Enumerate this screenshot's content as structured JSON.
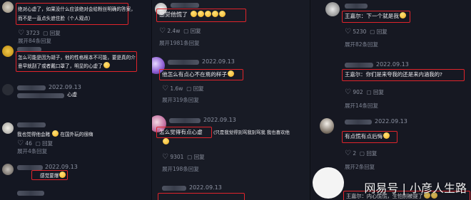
{
  "col1": {
    "c1": {
      "line1": "绝对心虚了，如果没什么应该绝对会给粉丝明确的答案，",
      "line2": "而不是一直点头遮住脸（个人观点）",
      "likes": "3723",
      "reply": "回复"
    },
    "c1_more": "展开84条回复",
    "c2": {
      "line1": "怎么可能是因为胡子，他的性格根本不可能，要是真的介",
      "line2": "意早就刮了或者戴口罩了，明显的心虚了"
    },
    "c3": {
      "date": "2022.09.13",
      "text": "心虚"
    },
    "c4": {
      "line1": "我也觉得他会赌",
      "line2": "在国外玩的很嗨",
      "likes": "46",
      "reply": "回复",
      "more": "展开4条回复"
    },
    "c5": {
      "date": "2022.09.13",
      "text": "感觉要爆"
    }
  },
  "col2": {
    "c1": {
      "text": "感觉他慌了",
      "likes": "2.4w",
      "reply": "回复",
      "more": "展开1981条回复"
    },
    "c2": {
      "date": "2022.09.13",
      "text": "他怎么有点心不在焉的样子",
      "likes": "1.6w",
      "reply": "回复",
      "more": "展开319条回复"
    },
    "c3": {
      "date": "2022.09.13",
      "text": "怎么觉得有点心虚",
      "text_extra": "(只是我觉得别骂我别骂我 我也喜欢他",
      "likes": "9301",
      "reply": "回复",
      "more": "展开198条回复"
    },
    "c4": {
      "date": "2022.09.13"
    }
  },
  "col3": {
    "c1": {
      "text": "王嘉尔：下一个就是我",
      "likes": "5230",
      "reply": "回复",
      "more": "展开82条回复"
    },
    "c2": {
      "date": "2022.09.13",
      "text": "王嘉尔：你们是来夸我的还是来内涵我的?",
      "likes": "902",
      "reply": "回复",
      "more": "展开14条回复"
    },
    "c3": {
      "date": "2022.09.13",
      "text": "有点慌有点后悔",
      "likes": "2",
      "reply": "回复",
      "more": "展开2条回复"
    },
    "c4": {
      "text": "王嘉尔：内心慌慌，生怕别被提了"
    }
  },
  "watermark": "网易号 | 小彦人生路",
  "colors": {
    "highlight": "#e0242b",
    "bg": "#161923"
  }
}
